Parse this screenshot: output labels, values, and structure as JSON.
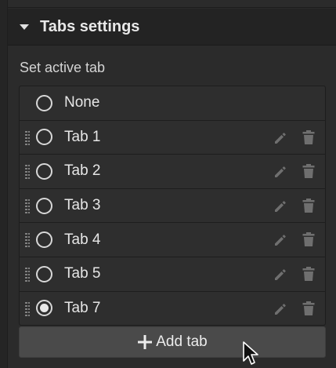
{
  "section": {
    "title": "Tabs settings"
  },
  "field": {
    "label": "Set active tab"
  },
  "options": [
    {
      "label": "None",
      "checked": false,
      "editable": false
    },
    {
      "label": "Tab 1",
      "checked": false,
      "editable": true
    },
    {
      "label": "Tab 2",
      "checked": false,
      "editable": true
    },
    {
      "label": "Tab 3",
      "checked": false,
      "editable": true
    },
    {
      "label": "Tab 4",
      "checked": false,
      "editable": true
    },
    {
      "label": "Tab 5",
      "checked": false,
      "editable": true
    },
    {
      "label": "Tab 7",
      "checked": true,
      "editable": true
    }
  ],
  "add_button": {
    "label": "Add tab",
    "icon": "plus-icon"
  },
  "icons": {
    "edit": "pencil-icon",
    "delete": "trash-icon",
    "drag": "drag-handle-icon",
    "caret": "caret-down-icon",
    "cursor": "mouse-cursor-icon"
  },
  "colors": {
    "panel": "#2b2b2b",
    "header": "#232323",
    "row": "#2e2e2e",
    "button": "#4a4a4a",
    "text": "#e6e6e6"
  }
}
